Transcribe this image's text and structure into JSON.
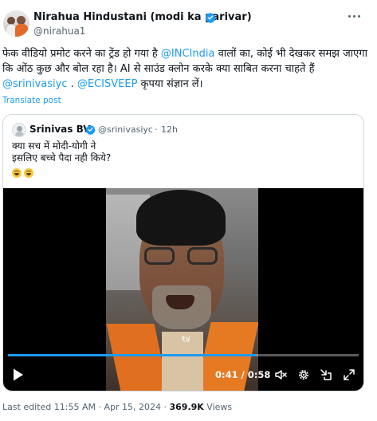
{
  "author": {
    "name": "Nirahua Hindustani (modi ka parivar)",
    "handle": "@nirahua1",
    "verified": true,
    "verified_color": "#1d9bf0"
  },
  "tweet": {
    "text_part1": "फेक वीडियो प्रमोट करने का ट्रेंड हो गया है ",
    "mention1": "@INCIndia",
    "text_part2": " वालों का, कोई भी देखकर समझ जाएगा कि ओंठ कुछ और बोल रहा है। AI से साउंड क्लोन करके क्या साबित करना चाहते हैं ",
    "mention2": "@srinivasiyc",
    "text_part3": " . ",
    "mention3": "@ECISVEEP",
    "text_part4": " कृपया संज्ञान लें।",
    "translate_label": "Translate post"
  },
  "quoted": {
    "name": "Srinivas BV",
    "handle": "@srinivasiyc",
    "separator": "·",
    "time": "12h",
    "line1": "क्या सच में मोदी-योगी ने",
    "line2": "इसलिए बच्चे पैदा नही किये?",
    "emojis": [
      "laughing-tears-emoji",
      "laughing-tears-emoji"
    ]
  },
  "video": {
    "current_time": "0:41",
    "duration": "0:58",
    "time_display": "0:41 / 0:58",
    "progress": 0.707,
    "caption_glyph": "९४",
    "icons": [
      "play-icon",
      "mute-icon",
      "settings-gear-icon",
      "exit-fullscreen-icon",
      "fullscreen-icon"
    ]
  },
  "footer": {
    "edited_label": "Last edited 11:55 AM · Apr 15, 2024 · ",
    "views_count": "369.9K",
    "views_label": " Views"
  },
  "colors": {
    "accent": "#1d9bf0",
    "text": "#0f1419",
    "secondary_text": "#536471",
    "border": "#cfd9de"
  }
}
